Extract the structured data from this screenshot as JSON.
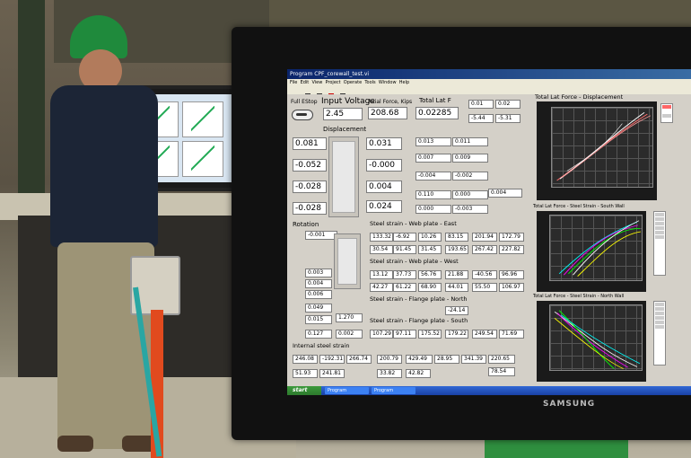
{
  "monitor_brand": "SAMSUNG",
  "window": {
    "title": "Program CPF_corewall_test.vi",
    "menu": [
      "File",
      "Edit",
      "View",
      "Project",
      "Operate",
      "Tools",
      "Window",
      "Help"
    ]
  },
  "controls": {
    "full_estop": "Full EStop",
    "input_voltage_label": "Input Voltage",
    "input_voltage": "2.45",
    "axial_force_label": "Axial Force, Kips",
    "axial_force": "208.68",
    "total_lat_label": "Total Lat F",
    "total_lat": "0.02285",
    "sp_small": [
      "0.01",
      "0.02",
      "-5.44",
      "-5.31"
    ]
  },
  "displacement": {
    "label": "Displacement",
    "left_values": [
      "0.081",
      "-0.052",
      "-0.028",
      "-0.028"
    ],
    "right_values": [
      "0.031",
      "-0.000",
      "0.004",
      "0.024"
    ],
    "out_of_plane": [
      "0.013",
      "0.011",
      "0.007",
      "0.009",
      "-0.004",
      "-0.002",
      "0.110",
      "0.000",
      "0.004",
      "0.000",
      "-0.003"
    ]
  },
  "rotation": {
    "label": "Rotation",
    "value": "-0.001",
    "values": [
      "0.003",
      "0.004",
      "0.006",
      "0.049",
      "0.015",
      "0.127",
      "0.002",
      "1.270"
    ]
  },
  "sections": {
    "web_east": "Steel strain - Web plate - East",
    "web_west": "Steel strain - Web plate - West",
    "flange_north": "Steel strain - Flange plate - North",
    "flange_south": "Steel strain - Flange plate - South",
    "internal": "Internal steel strain"
  },
  "strain_values": {
    "web_east": [
      "133.32",
      "-6.92",
      "10.26",
      "83.15",
      "201.94",
      "172.79",
      "30.54",
      "91.45",
      "31.45",
      "193.65",
      "267.42",
      "227.82"
    ],
    "web_west": [
      "13.12",
      "37.73",
      "56.76",
      "21.88",
      "-40.56",
      "96.96",
      "42.27",
      "61.22",
      "68.90",
      "44.01",
      "55.50",
      "106.97"
    ],
    "flange_north": "-24.14",
    "flange_south": [
      "107.29",
      "97.11",
      "175.52",
      "179.22",
      "249.54",
      "71.69"
    ],
    "internal": [
      "246.08",
      "-192.31",
      "266.74",
      "200.79",
      "429.49",
      "28.95",
      "341.39",
      "220.65",
      "51.93",
      "241.81",
      "33.82",
      "42.82",
      "78.54"
    ]
  },
  "plots": {
    "top_title": "Total Lat Force - Displacement",
    "mid_title": "Total Lat Force - Steel Strain - South Wall",
    "bot_title": "Total Lat Force - Steel Strain - North Wall"
  },
  "taskbar": {
    "start": "start",
    "items": [
      "Program CPF_corew...",
      "Program CPF_corew..."
    ]
  },
  "colors": {
    "titlebar": "#0a246a",
    "panel": "#d4d0c8",
    "plot_bg": "#2b2b2b"
  }
}
